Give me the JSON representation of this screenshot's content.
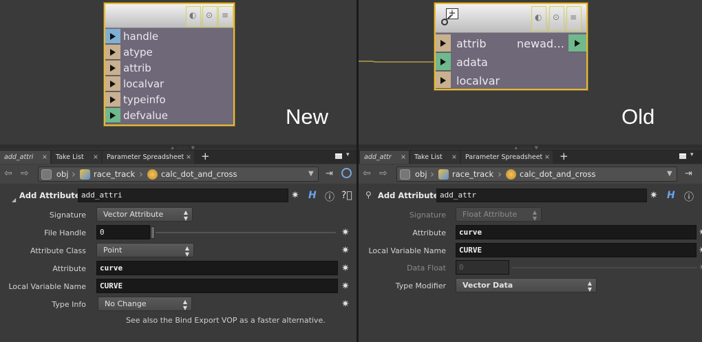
{
  "left": {
    "caption": "New",
    "node": {
      "inputs": [
        {
          "label": "handle",
          "color": "#7fb0d3"
        },
        {
          "label": "atype",
          "color": "#c9b08e"
        },
        {
          "label": "attrib",
          "color": "#c9b08e"
        },
        {
          "label": "localvar",
          "color": "#c9b08e"
        },
        {
          "label": "typeinfo",
          "color": "#c9b08e"
        },
        {
          "label": "defvalue",
          "color": "#6fb98c"
        }
      ]
    },
    "tabs": [
      "add_attri",
      "Take List",
      "Parameter Spreadsheet"
    ],
    "path": [
      "obj",
      "race_track",
      "calc_dot_and_cross"
    ],
    "node_type": "Add Attribute",
    "node_name": "add_attri",
    "help_icon": "H",
    "params": {
      "signature": {
        "label": "Signature",
        "value": "Vector Attribute"
      },
      "file_handle": {
        "label": "File Handle",
        "value": "0"
      },
      "attribute_class": {
        "label": "Attribute Class",
        "value": "Point"
      },
      "attribute": {
        "label": "Attribute",
        "value": "curve"
      },
      "local_variable_name": {
        "label": "Local Variable Name",
        "value": "CURVE"
      },
      "type_info": {
        "label": "Type Info",
        "value": "No Change"
      }
    },
    "note": "See also the Bind Export VOP as a faster alternative."
  },
  "right": {
    "caption": "Old",
    "node": {
      "inputs": [
        {
          "label": "attrib",
          "color": "#c9b08e"
        },
        {
          "label": "adata",
          "color": "#6fb98c"
        },
        {
          "label": "localvar",
          "color": "#c9b08e"
        }
      ],
      "output": {
        "label": "newad…",
        "color": "#6fb98c"
      }
    },
    "tabs": [
      "add_attr",
      "Take List",
      "Parameter Spreadsheet"
    ],
    "path": [
      "obj",
      "race_track",
      "calc_dot_and_cross"
    ],
    "node_type": "Add Attribute",
    "node_name": "add_attr",
    "help_icon": "H",
    "params": {
      "signature": {
        "label": "Signature",
        "value": "Float Attribute"
      },
      "attribute": {
        "label": "Attribute",
        "value": "curve"
      },
      "local_variable_name": {
        "label": "Local Variable Name",
        "value": "CURVE"
      },
      "data_float": {
        "label": "Data Float",
        "value": "0"
      },
      "type_modifier": {
        "label": "Type Modifier",
        "value": "Vector Data"
      }
    }
  },
  "icons": {
    "tab_close": "×",
    "add_tab": "+",
    "back": "back-arrow-icon",
    "forward": "forward-arrow-icon",
    "gear": "gear-icon",
    "info": "info-icon",
    "help": "help-icon"
  },
  "colors": {
    "node_selected_border": "#e7b93b",
    "node_body": "#6e6878",
    "wire": "#b4a04a"
  }
}
